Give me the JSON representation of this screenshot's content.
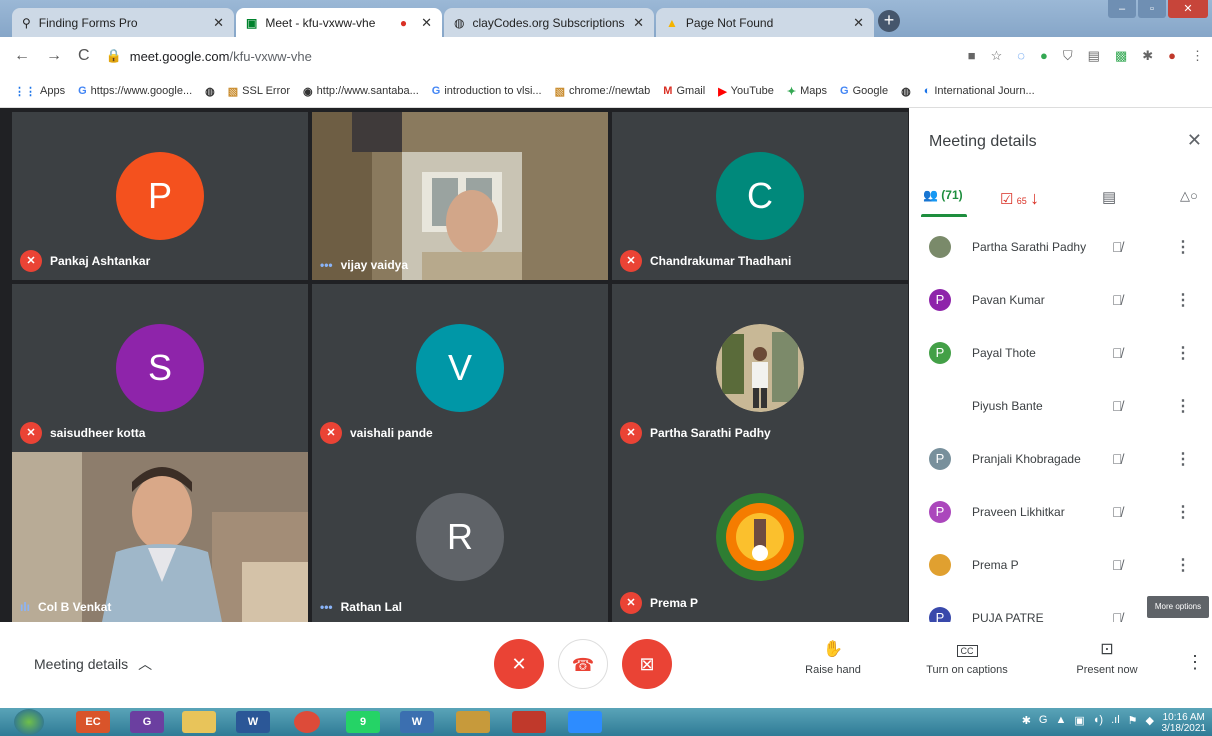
{
  "browser": {
    "tabs": [
      {
        "title": "Finding Forms Pro",
        "icon": "search-icon"
      },
      {
        "title": "Meet - kfu-vxww-vhe",
        "icon": "meet-icon"
      },
      {
        "title": "clayCodes.org Subscriptions",
        "icon": "globe-icon"
      },
      {
        "title": "Page Not Found",
        "icon": "drive-icon"
      }
    ],
    "new_tab": "+",
    "url_host": "meet.google.com",
    "url_path": "/kfu-vxww-vhe",
    "bookmarks": [
      {
        "label": "Apps",
        "icon": "apps-icon"
      },
      {
        "label": "https://www.google...",
        "icon": "google-icon"
      },
      {
        "label": "",
        "icon": "globe-icon"
      },
      {
        "label": "SSL Error",
        "icon": "image-icon"
      },
      {
        "label": "http://www.santaba...",
        "icon": "santaba-icon"
      },
      {
        "label": "introduction to vlsi...",
        "icon": "google-icon"
      },
      {
        "label": "chrome://newtab",
        "icon": "image-icon"
      },
      {
        "label": "Gmail",
        "icon": "gmail-icon"
      },
      {
        "label": "YouTube",
        "icon": "youtube-icon"
      },
      {
        "label": "Maps",
        "icon": "maps-icon"
      },
      {
        "label": "Google",
        "icon": "google-icon"
      },
      {
        "label": "",
        "icon": "globe-icon"
      },
      {
        "label": "International Journ...",
        "icon": "journal-icon"
      }
    ]
  },
  "grid": {
    "tiles": [
      {
        "name": "Pankaj Ashtankar",
        "initial": "P",
        "color": "#f4511e",
        "status": "muted"
      },
      {
        "name": "vijay vaidya",
        "initial": "",
        "color": "",
        "status": "speaking-dots"
      },
      {
        "name": "Chandrakumar Thadhani",
        "initial": "C",
        "color": "#00897b",
        "status": "muted"
      },
      {
        "name": "saisudheer kotta",
        "initial": "S",
        "color": "#8e24aa",
        "status": "muted"
      },
      {
        "name": "vaishali pande",
        "initial": "V",
        "color": "#0097a7",
        "status": "muted"
      },
      {
        "name": "Partha Sarathi Padhy",
        "initial": "",
        "color": "",
        "status": "muted"
      },
      {
        "name": "Col B Venkat",
        "initial": "",
        "color": "",
        "status": "speaking"
      },
      {
        "name": "Rathan Lal",
        "initial": "R",
        "color": "#5f6368",
        "status": "speaking-dots"
      },
      {
        "name": "Prema P",
        "initial": "",
        "color": "",
        "status": "muted"
      }
    ]
  },
  "panel": {
    "title": "Meeting details",
    "people_count": "(71)",
    "tasks_count": "65",
    "participants": [
      {
        "name": "Partha Sarathi Padhy",
        "initial": "",
        "color": "#7a8a6a"
      },
      {
        "name": "Pavan Kumar",
        "initial": "P",
        "color": "#8e24aa"
      },
      {
        "name": "Payal Thote",
        "initial": "P",
        "color": "#43a047"
      },
      {
        "name": "Piyush Bante",
        "initial": "",
        "color": "#ffffff"
      },
      {
        "name": "Pranjali Khobragade",
        "initial": "P",
        "color": "#78909c"
      },
      {
        "name": "Praveen Likhitkar",
        "initial": "P",
        "color": "#ab47bc"
      },
      {
        "name": "Prema P",
        "initial": "",
        "color": "#e0a030"
      },
      {
        "name": "PUJA PATRE",
        "initial": "P",
        "color": "#3949ab"
      }
    ],
    "tooltip": "More options"
  },
  "bottom": {
    "meeting_details": "Meeting details",
    "raise_hand": "Raise hand",
    "captions": "Turn on captions",
    "present": "Present now",
    "cc": "CC"
  },
  "taskbar": {
    "time": "10:16 AM",
    "date": "3/18/2021",
    "apps": [
      {
        "icon": "ec-icon",
        "label": "EC",
        "color": "#d9542a"
      },
      {
        "icon": "g-app-icon",
        "label": "G",
        "color": "#6b3fa0"
      },
      {
        "icon": "folder-icon",
        "label": "",
        "color": "#e8c45a"
      },
      {
        "icon": "word-icon",
        "label": "W",
        "color": "#2b5797"
      },
      {
        "icon": "chrome-icon",
        "label": "",
        "color": "#dd4b39"
      },
      {
        "icon": "whatsapp-icon",
        "label": "9",
        "color": "#25d366"
      },
      {
        "icon": "word-doc-icon",
        "label": "W",
        "color": "#3b6fb0"
      },
      {
        "icon": "paint-icon",
        "label": "",
        "color": "#c79a3b"
      },
      {
        "icon": "snip-icon",
        "label": "",
        "color": "#c0392b"
      },
      {
        "icon": "zoom-icon",
        "label": "",
        "color": "#2d8cff"
      }
    ]
  }
}
